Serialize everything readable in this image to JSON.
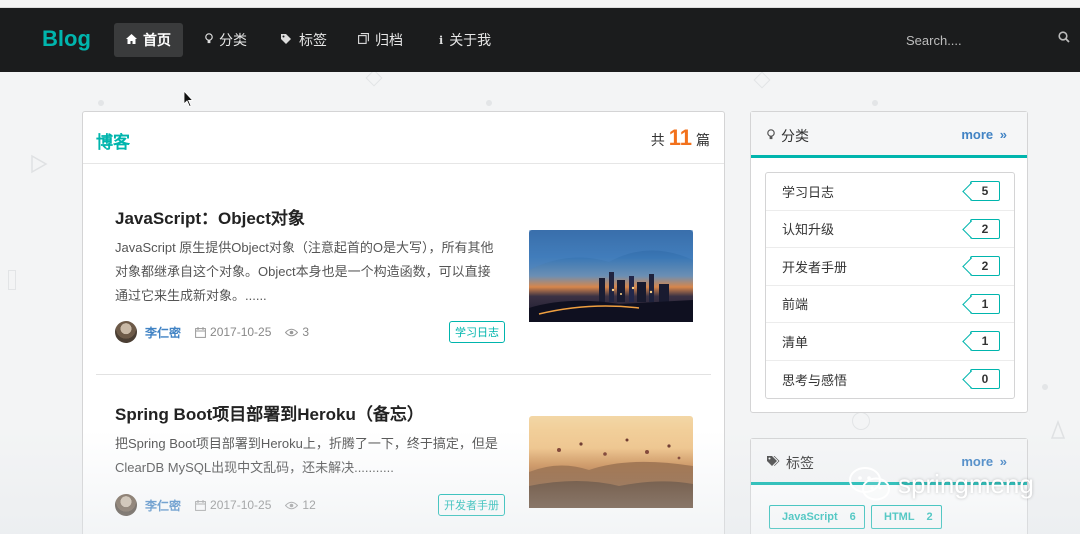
{
  "navbar": {
    "brand": "Blog",
    "items": [
      {
        "icon": "home-icon",
        "label": "首页",
        "active": true
      },
      {
        "icon": "lightbulb-icon",
        "label": "分类",
        "active": false
      },
      {
        "icon": "tags-icon",
        "label": "标签",
        "active": false
      },
      {
        "icon": "archive-icon",
        "label": "归档",
        "active": false
      },
      {
        "icon": "info-icon",
        "label": "关于我",
        "active": false
      }
    ],
    "search_placeholder": "Search...."
  },
  "main": {
    "title": "博客",
    "count_prefix": "共",
    "count": "11",
    "count_suffix": "篇",
    "posts": [
      {
        "title": "JavaScript：Object对象",
        "excerpt": "JavaScript 原生提供Object对象（注意起首的O是大写），所有其他对象都继承自这个对象。Object本身也是一个构造函数，可以直接通过它来生成新对象。......",
        "author": "李仁密",
        "date": "2017-10-25",
        "views": "3",
        "tag": "学习日志"
      },
      {
        "title": "Spring Boot项目部署到Heroku（备忘）",
        "excerpt": "把Spring Boot项目部署到Heroku上，折腾了一下，终于搞定，但是ClearDB MySQL出现中文乱码，还未解决...........",
        "author": "李仁密",
        "date": "2017-10-25",
        "views": "12",
        "tag": "开发者手册"
      }
    ]
  },
  "sidebar": {
    "categories": {
      "title": "分类",
      "more": "more",
      "items": [
        {
          "name": "学习日志",
          "count": "5"
        },
        {
          "name": "认知升级",
          "count": "2"
        },
        {
          "name": "开发者手册",
          "count": "2"
        },
        {
          "name": "前端",
          "count": "1"
        },
        {
          "name": "清单",
          "count": "1"
        },
        {
          "name": "思考与感悟",
          "count": "0"
        }
      ]
    },
    "tags": {
      "title": "标签",
      "more": "more",
      "items": [
        {
          "name": "JavaScript",
          "count": "6"
        },
        {
          "name": "HTML",
          "count": "2"
        }
      ]
    }
  },
  "watermark": {
    "text": "springmeng"
  },
  "colors": {
    "accent": "#00b5ad",
    "count": "#f2711c",
    "link": "#4183c4",
    "navbar": "#1b1c1d"
  }
}
